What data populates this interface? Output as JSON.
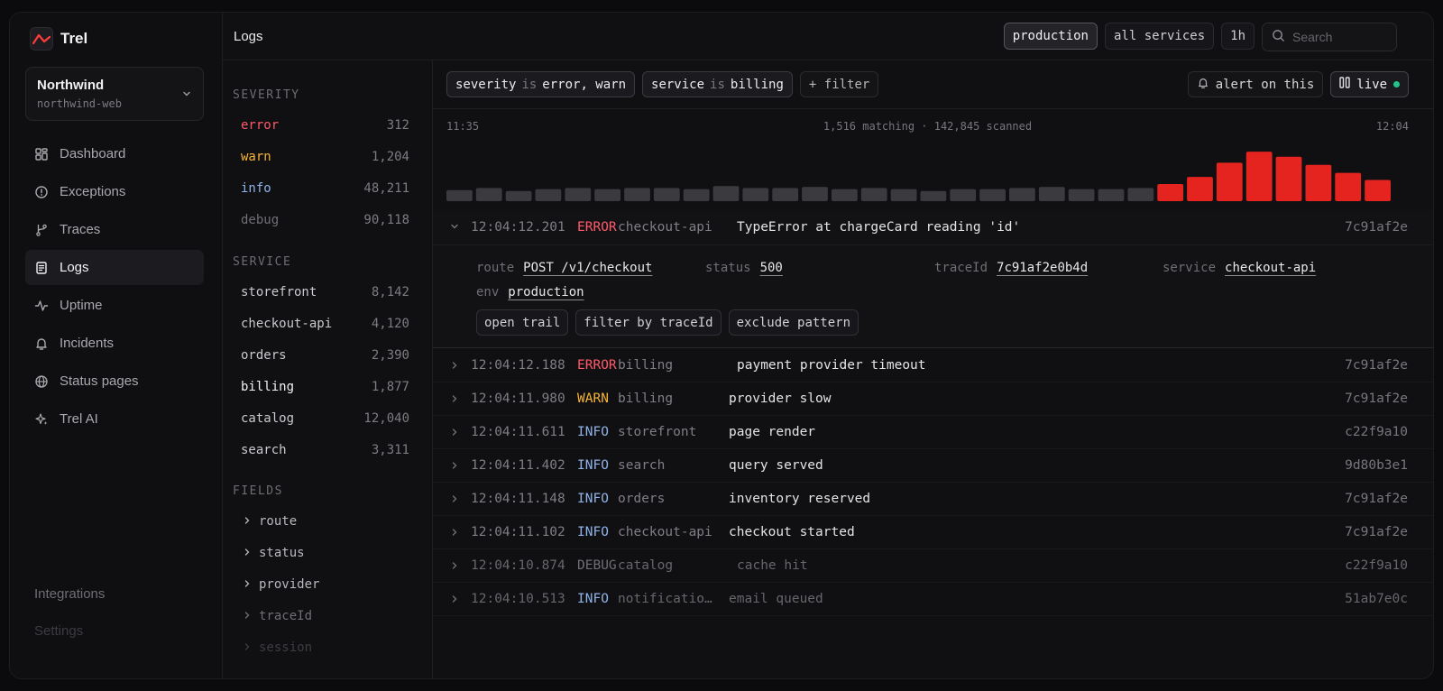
{
  "brand": {
    "name": "Trel"
  },
  "org": {
    "name": "Northwind",
    "project": "northwind-web"
  },
  "nav": [
    {
      "label": "Dashboard",
      "icon": "dashboard-icon",
      "active": false
    },
    {
      "label": "Exceptions",
      "icon": "alert-circle-icon",
      "active": false
    },
    {
      "label": "Traces",
      "icon": "git-branch-icon",
      "active": false
    },
    {
      "label": "Logs",
      "icon": "logs-icon",
      "active": true
    },
    {
      "label": "Uptime",
      "icon": "activity-icon",
      "active": false
    },
    {
      "label": "Incidents",
      "icon": "bell-icon",
      "active": false
    },
    {
      "label": "Status pages",
      "icon": "globe-icon",
      "active": false
    },
    {
      "label": "Trel AI",
      "icon": "sparkles-icon",
      "active": false
    }
  ],
  "nav_bottom": {
    "integrations": "Integrations",
    "settings": "Settings"
  },
  "header": {
    "title": "Logs",
    "env": "production",
    "services": "all services",
    "range": "1h",
    "search_placeholder": "Search"
  },
  "facets": {
    "severity_heading": "SEVERITY",
    "severity": [
      {
        "label": "error",
        "count": "312",
        "color": "#ff5a6a"
      },
      {
        "label": "warn",
        "count": "1,204",
        "color": "#f6b436"
      },
      {
        "label": "info",
        "count": "48,211",
        "color": "#8fb3e8"
      },
      {
        "label": "debug",
        "count": "90,118",
        "color": "#6f6f76"
      }
    ],
    "service_heading": "SERVICE",
    "service": [
      {
        "label": "storefront",
        "count": "8,142"
      },
      {
        "label": "checkout-api",
        "count": "4,120"
      },
      {
        "label": "orders",
        "count": "2,390"
      },
      {
        "label": "billing",
        "count": "1,877"
      },
      {
        "label": "catalog",
        "count": "12,040"
      },
      {
        "label": "search",
        "count": "3,311"
      }
    ],
    "fields_heading": "FIELDS",
    "fields": [
      "route",
      "status",
      "provider",
      "traceId",
      "session"
    ]
  },
  "filters": {
    "chips": [
      {
        "key": "severity",
        "op": "is",
        "value": "error, warn"
      },
      {
        "key": "service",
        "op": "is",
        "value": "billing"
      }
    ],
    "add_label": "+ filter",
    "alert_label": "alert on this",
    "live_label": "live"
  },
  "histogram": {
    "start": "11:35",
    "end": "12:04",
    "summary": "1,516 matching · 142,845 scanned",
    "bars": [
      0.22,
      0.26,
      0.2,
      0.24,
      0.26,
      0.24,
      0.26,
      0.26,
      0.24,
      0.3,
      0.26,
      0.26,
      0.28,
      0.24,
      0.26,
      0.24,
      0.2,
      0.24,
      0.24,
      0.26,
      0.28,
      0.24,
      0.24,
      0.26,
      0.34,
      0.48,
      0.76,
      0.98,
      0.88,
      0.72,
      0.56,
      0.42
    ],
    "bar_color": "#3a3a3f",
    "error_color": "#e5231f",
    "error_from_index": 24
  },
  "expanded": {
    "time": "12:04:12.201",
    "level": "ERROR",
    "service": "checkout-api",
    "message": "TypeError at chargeCard reading 'id'",
    "trace": "7c91af2e",
    "fields": [
      {
        "key": "route",
        "value": "POST /v1/checkout"
      },
      {
        "key": "status",
        "value": "500"
      },
      {
        "key": "traceId",
        "value": "7c91af2e0b4d"
      },
      {
        "key": "service",
        "value": "checkout-api"
      },
      {
        "key": "env",
        "value": "production"
      }
    ],
    "actions": [
      "open trail",
      "filter by traceId",
      "exclude pattern"
    ]
  },
  "logs": [
    {
      "time": "12:04:12.188",
      "level": "ERROR",
      "service": "billing",
      "message": "payment provider timeout",
      "trace": "7c91af2e"
    },
    {
      "time": "12:04:11.980",
      "level": "WARN",
      "service": "billing",
      "message": "provider slow",
      "trace": "7c91af2e"
    },
    {
      "time": "12:04:11.611",
      "level": "INFO",
      "service": "storefront",
      "message": "page render",
      "trace": "c22f9a10"
    },
    {
      "time": "12:04:11.402",
      "level": "INFO",
      "service": "search",
      "message": "query served",
      "trace": "9d80b3e1"
    },
    {
      "time": "12:04:11.148",
      "level": "INFO",
      "service": "orders",
      "message": "inventory reserved",
      "trace": "7c91af2e"
    },
    {
      "time": "12:04:11.102",
      "level": "INFO",
      "service": "checkout-api",
      "message": "checkout started",
      "trace": "7c91af2e"
    },
    {
      "time": "12:04:10.874",
      "level": "DEBUG",
      "service": "catalog",
      "message": "cache hit",
      "trace": "c22f9a10"
    },
    {
      "time": "12:04:10.513",
      "level": "INFO",
      "service": "notificatio…",
      "message": "email queued",
      "trace": "51ab7e0c"
    }
  ]
}
